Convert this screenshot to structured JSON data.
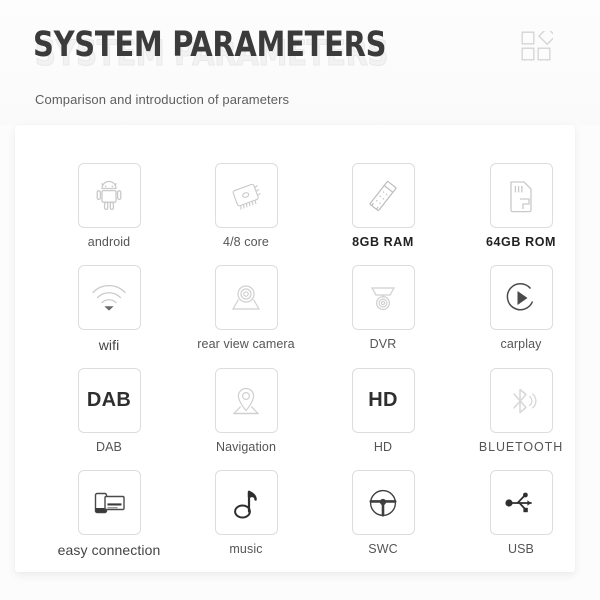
{
  "header": {
    "title": "SYSTEM PARAMETERS",
    "subtitle": "Comparison and introduction of parameters",
    "decor_icon": "squares-diamond-icon",
    "title_color": "#3b3b3b",
    "shadow_color": "#f2f2f2",
    "subtitle_color": "#5e5e5e"
  },
  "panel": {
    "background": "#ffffff",
    "card_border_color": "#dddddd"
  },
  "grid": {
    "columns": 4,
    "rows": 4,
    "items": [
      {
        "id": "android",
        "icon": "android-robot-icon",
        "card_text": "",
        "label": "android",
        "label_style": "normal"
      },
      {
        "id": "core",
        "icon": "cpu-chip-icon",
        "card_text": "",
        "label": "4/8  core",
        "label_style": "normal"
      },
      {
        "id": "ram",
        "icon": "memory-stick-icon",
        "card_text": "",
        "label": "8GB  RAM",
        "label_style": "bold"
      },
      {
        "id": "rom",
        "icon": "sd-card-icon",
        "card_text": "",
        "label": "64GB  ROM",
        "label_style": "bold"
      },
      {
        "id": "wifi",
        "icon": "wifi-icon",
        "card_text": "",
        "label": "wifi",
        "label_style": "big"
      },
      {
        "id": "rear-view-camera",
        "icon": "rear-camera-icon",
        "card_text": "",
        "label": "rear view camera",
        "label_style": "normal"
      },
      {
        "id": "dvr",
        "icon": "dome-camera-icon",
        "card_text": "",
        "label": "DVR",
        "label_style": "normal"
      },
      {
        "id": "carplay",
        "icon": "play-circle-icon",
        "card_text": "",
        "label": "carplay",
        "label_style": "normal"
      },
      {
        "id": "dab",
        "icon": "text-icon",
        "card_text": "DAB",
        "label": "DAB",
        "label_style": "normal"
      },
      {
        "id": "navigation",
        "icon": "map-pin-icon",
        "card_text": "",
        "label": "Navigation",
        "label_style": "normal"
      },
      {
        "id": "hd",
        "icon": "text-icon",
        "card_text": "HD",
        "label": "HD",
        "label_style": "normal"
      },
      {
        "id": "bluetooth",
        "icon": "bluetooth-icon",
        "card_text": "",
        "label": "BLUETOOTH",
        "label_style": "wide"
      },
      {
        "id": "easy-connection",
        "icon": "screen-mirror-icon",
        "card_text": "",
        "label": "easy connection",
        "label_style": "big"
      },
      {
        "id": "music",
        "icon": "music-note-icon",
        "card_text": "",
        "label": "music",
        "label_style": "normal"
      },
      {
        "id": "swc",
        "icon": "steering-wheel-icon",
        "card_text": "",
        "label": "SWC",
        "label_style": "normal"
      },
      {
        "id": "usb",
        "icon": "usb-icon",
        "card_text": "",
        "label": "USB",
        "label_style": "normal"
      }
    ]
  }
}
